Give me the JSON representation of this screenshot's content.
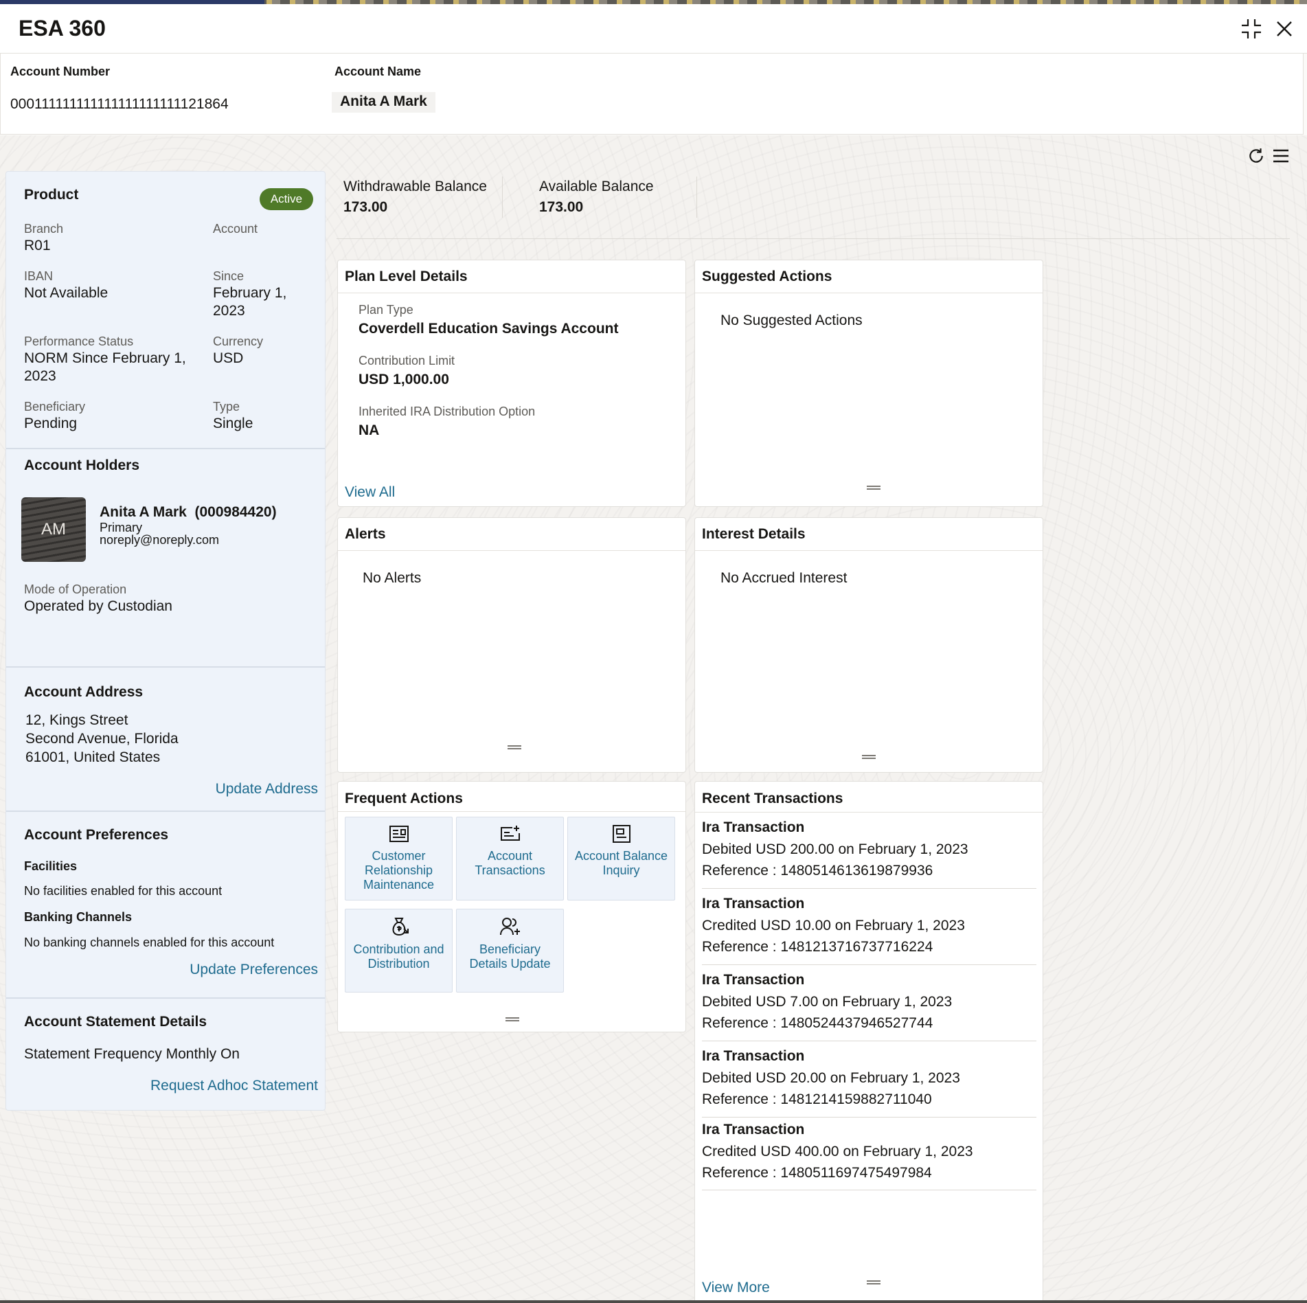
{
  "window": {
    "title": "ESA 360"
  },
  "account_bar": {
    "number_label": "Account Number",
    "number": "000111111111111111111111121864",
    "name_label": "Account Name",
    "name": "Anita A Mark"
  },
  "product": {
    "title": "Product",
    "status": "Active",
    "branch_label": "Branch",
    "branch": "R01",
    "account_label": "Account",
    "iban_label": "IBAN",
    "iban": "Not Available",
    "since_label": "Since",
    "since_line1": "February 1,",
    "since_line2": "2023",
    "perf_label": "Performance Status",
    "perf_line1": "NORM Since February 1,",
    "perf_line2": "2023",
    "currency_label": "Currency",
    "currency": "USD",
    "beneficiary_label": "Beneficiary",
    "beneficiary": "Pending",
    "type_label": "Type",
    "type": "Single"
  },
  "holders": {
    "title": "Account Holders",
    "initials": "AM",
    "name": "Anita A Mark",
    "id": "(000984420)",
    "role": "Primary",
    "email": "noreply@noreply.com",
    "mode_label": "Mode of Operation",
    "mode": "Operated by Custodian"
  },
  "address": {
    "title": "Account Address",
    "line1": "12, Kings Street",
    "line2": "Second Avenue, Florida",
    "line3": "61001, United States",
    "link": "Update Address"
  },
  "preferences": {
    "title": "Account Preferences",
    "facilities_label": "Facilities",
    "facilities": "No facilities enabled for this account",
    "channels_label": "Banking Channels",
    "channels": "No banking channels enabled for this account",
    "link": "Update Preferences"
  },
  "statement": {
    "title": "Account Statement Details",
    "text": "Statement Frequency Monthly On",
    "link": "Request Adhoc Statement"
  },
  "balances": [
    {
      "label": "Withdrawable Balance",
      "value": "173.00"
    },
    {
      "label": "Available Balance",
      "value": "173.00"
    }
  ],
  "plan": {
    "title": "Plan Level Details",
    "type_label": "Plan Type",
    "type": "Coverdell Education Savings Account",
    "limit_label": "Contribution Limit",
    "limit": "USD 1,000.00",
    "option_label": "Inherited IRA Distribution Option",
    "option": "NA",
    "link": "View All"
  },
  "suggested": {
    "title": "Suggested Actions",
    "empty": "No Suggested Actions"
  },
  "alerts": {
    "title": "Alerts",
    "empty": "No Alerts"
  },
  "interest": {
    "title": "Interest Details",
    "empty": "No Accrued Interest"
  },
  "frequent": {
    "title": "Frequent Actions",
    "tiles": [
      {
        "line1": "Customer",
        "line2": "Relationship",
        "line3": "Maintenance",
        "icon": "id-card-icon"
      },
      {
        "line1": "Account",
        "line2": "Transactions",
        "line3": "",
        "icon": "card-plus-icon"
      },
      {
        "line1": "Account Balance",
        "line2": "Inquiry",
        "line3": "",
        "icon": "ledger-icon"
      },
      {
        "line1": "Contribution and",
        "line2": "Distribution",
        "line3": "",
        "icon": "money-bag-icon"
      },
      {
        "line1": "Beneficiary",
        "line2": "Details Update",
        "line3": "",
        "icon": "user-plus-icon"
      }
    ]
  },
  "recent": {
    "title": "Recent Transactions",
    "items": [
      {
        "title": "Ira Transaction",
        "detail": "Debited USD 200.00 on February 1, 2023",
        "ref": "Reference : 1480514613619879936"
      },
      {
        "title": "Ira Transaction",
        "detail": "Credited USD 10.00 on February 1, 2023",
        "ref": "Reference : 1481213716737716224"
      },
      {
        "title": "Ira Transaction",
        "detail": "Debited USD 7.00 on February 1, 2023",
        "ref": "Reference : 1480524437946527744"
      },
      {
        "title": "Ira Transaction",
        "detail": "Debited USD 20.00 on February 1, 2023",
        "ref": "Reference : 1481214159882711040"
      },
      {
        "title": "Ira Transaction",
        "detail": "Credited USD 400.00 on February 1, 2023",
        "ref": "Reference : 1480511697475497984"
      }
    ],
    "link": "View More"
  },
  "colors": {
    "accent_link": "#1e6b8e",
    "active_badge": "#4f7a28",
    "panel_bg": "#eef3fa"
  }
}
